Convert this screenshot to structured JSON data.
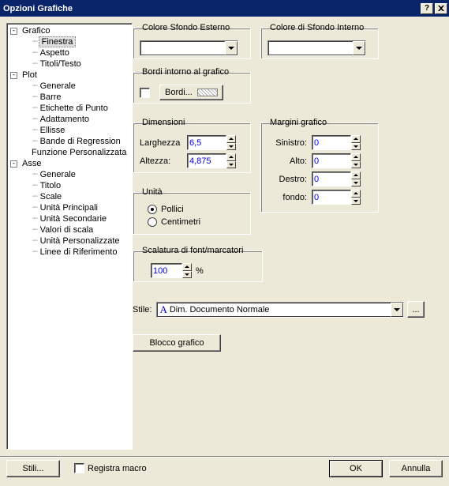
{
  "title": "Opzioni Grafiche",
  "tree": {
    "grafico": "Grafico",
    "finestra": "Finestra",
    "aspetto": "Aspetto",
    "titoli": "Titoli/Testo",
    "plot": "Plot",
    "generale": "Generale",
    "barre": "Barre",
    "etichette": "Etichette di Punto",
    "adattamento": "Adattamento",
    "ellisse": "Ellisse",
    "bande": "Bande di Regression",
    "funzione": "Funzione Personalizzata",
    "asse": "Asse",
    "a_generale": "Generale",
    "a_titolo": "Titolo",
    "a_scale": "Scale",
    "a_unitap": "Unità Principali",
    "a_unitas": "Unità Secondarie",
    "a_valori": "Valori di scala",
    "a_unitaper": "Unità Personalizzate",
    "a_linee": "Linee di Riferimento"
  },
  "groups": {
    "colore_esterno": "Colore Sfondo Esterno",
    "colore_interno": "Colore di Sfondo Interno",
    "bordi": "Bordi intorno al grafico",
    "bordi_btn": "Bordi...",
    "dimensioni": "Dimensioni",
    "larghezza": "Larghezza",
    "altezza": "Altezza:",
    "margini": "Margini grafico",
    "sinistro": "Sinistro:",
    "alto": "Alto:",
    "destro": "Destro:",
    "fondo": "fondo:",
    "unita": "Unità",
    "pollici": "Pollici",
    "centimetri": "Centimetri",
    "scalatura": "Scalatura di font/marcatori",
    "stile": "Stile:",
    "stile_val": "Dim. Documento Normale",
    "blocco": "Blocco grafico"
  },
  "values": {
    "larghezza": "6,5",
    "altezza": "4,875",
    "sinistro": "0",
    "alto": "0",
    "destro": "0",
    "fondo": "0",
    "scala": "100",
    "percent": "%"
  },
  "footer": {
    "stili": "Stili...",
    "registra": "Registra macro",
    "ok": "OK",
    "annulla": "Annulla",
    "dots": "..."
  }
}
